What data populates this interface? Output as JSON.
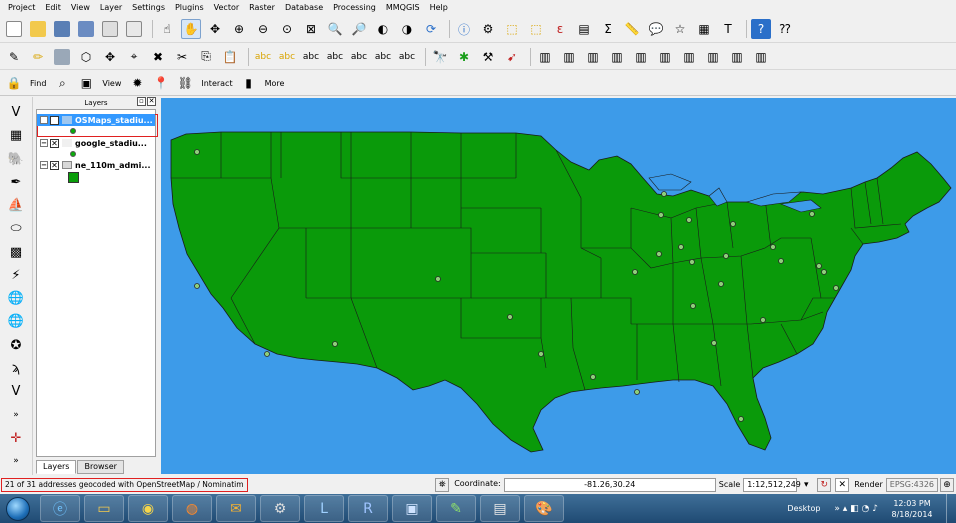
{
  "menubar": {
    "items": [
      "Project",
      "Edit",
      "View",
      "Layer",
      "Settings",
      "Plugins",
      "Vector",
      "Raster",
      "Database",
      "Processing",
      "MMQGIS",
      "Help"
    ]
  },
  "toolbar3": {
    "find_label": "Find",
    "view_label": "View",
    "interact_label": "Interact",
    "more_label": "More"
  },
  "layers_panel": {
    "title": "Layers",
    "layers": [
      {
        "name": "OSMaps_stadiu...",
        "selected": true
      },
      {
        "name": "google_stadiu...",
        "selected": false
      },
      {
        "name": "ne_110m_admi...",
        "selected": false
      }
    ],
    "tabs": [
      "Layers",
      "Browser"
    ]
  },
  "statusbar": {
    "message": "21 of 31 addresses geocoded with OpenStreetMap / Nominatim",
    "coordinate_label": "Coordinate:",
    "coordinate_value": "-81.26,30.24",
    "scale_label": "Scale",
    "scale_value": "1:12,512,249",
    "render_label": "Render",
    "crs": "EPSG:4326"
  },
  "taskbar": {
    "desktop_label": "Desktop",
    "time": "12:03 PM",
    "date": "8/18/2014"
  },
  "map": {
    "ocean_color": "#3d9be9",
    "land_color": "#0a9a0a"
  }
}
